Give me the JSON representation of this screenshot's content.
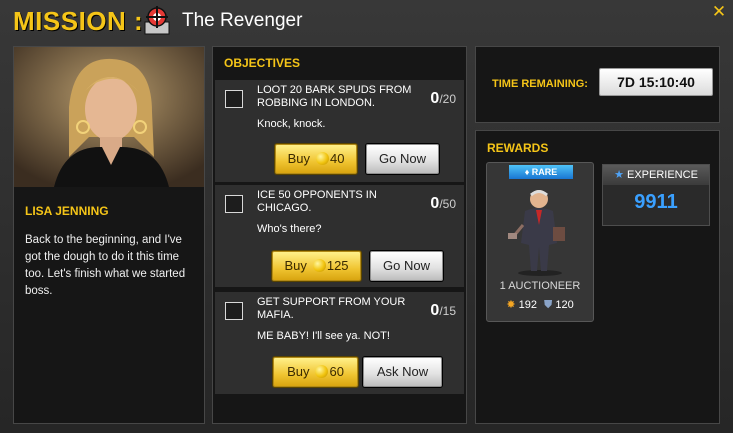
{
  "header": {
    "mission_label": "MISSION :",
    "title": "The Revenger",
    "close_icon": "close-icon"
  },
  "character": {
    "name": "LISA JENNING",
    "description": "Back to the beginning, and I've got the dough to do it this time too. Let's finish what we started boss."
  },
  "objectives": {
    "heading": "OBJECTIVES",
    "items": [
      {
        "title": "LOOT 20 BARK SPUDS FROM ROBBING IN LONDON.",
        "quote": "Knock, knock.",
        "progress": "0",
        "total": "/20",
        "buy_label": "Buy",
        "buy_cost": "40",
        "action_label": "Go Now"
      },
      {
        "title": "ICE 50 OPPONENTS IN CHICAGO.",
        "quote": "Who's there?",
        "progress": "0",
        "total": "/50",
        "buy_label": "Buy",
        "buy_cost": "125",
        "action_label": "Go Now"
      },
      {
        "title": "GET SUPPORT FROM YOUR MAFIA.",
        "quote": "ME BABY! I'll see ya. NOT!",
        "progress": "0",
        "total": "/15",
        "buy_label": "Buy",
        "buy_cost": "60",
        "action_label": "Ask Now"
      }
    ]
  },
  "timer": {
    "label": "TIME REMAINING:",
    "value": "7D 15:10:40"
  },
  "rewards": {
    "heading": "REWARDS",
    "item": {
      "rarity": "RARE",
      "name": "1 AUCTIONEER",
      "attack": "192",
      "defense": "120"
    },
    "experience": {
      "label": "EXPERIENCE",
      "value": "9911"
    }
  },
  "colors": {
    "accent": "#f5c518",
    "experience_value": "#3aa0ff",
    "rare_badge": "#1e88e5"
  }
}
